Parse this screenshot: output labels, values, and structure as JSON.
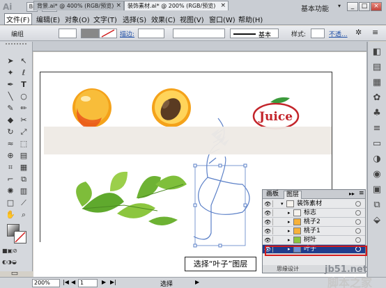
{
  "app": {
    "logo": "Ai",
    "workspace": "基本功能",
    "menus": [
      "文件(F)",
      "编辑(E)",
      "对象(O)",
      "文字(T)",
      "选择(S)",
      "效果(C)",
      "视图(V)",
      "窗口(W)",
      "帮助(H)"
    ]
  },
  "controlbar": {
    "mode_label": "编组",
    "stroke_label": "描边:",
    "style_name": "基本",
    "style_label": "样式:",
    "opacity_label": "不透..."
  },
  "tabs": [
    {
      "label": "背景.ai* @ 400% (RGB/预览)",
      "close": "×"
    },
    {
      "label": "装饰素材.ai* @ 200% (RGB/预览)",
      "close": "×"
    }
  ],
  "canvas": {
    "logo_text": "Juice"
  },
  "layers_panel": {
    "tabs": [
      "画板",
      "图层"
    ],
    "rows": [
      {
        "name": "装饰素材",
        "indent": 0,
        "selected": false
      },
      {
        "name": "标志",
        "indent": 1,
        "selected": false
      },
      {
        "name": "桃子2",
        "indent": 1,
        "selected": false
      },
      {
        "name": "桃子1",
        "indent": 1,
        "selected": false
      },
      {
        "name": "树叶",
        "indent": 1,
        "selected": false
      },
      {
        "name": "叶子",
        "indent": 1,
        "selected": true
      }
    ],
    "footer": "思缘设计"
  },
  "callout": "选择“叶子”图层",
  "statusbar": {
    "zoom": "200%",
    "page": "1",
    "tool": "选择"
  },
  "watermark": {
    "line1": "jb51.net",
    "line2": "脚本之家"
  },
  "colors": {
    "selection": "#1f3c8c",
    "highlight_box": "#d41b1b",
    "path_blue": "#5a7fc7"
  }
}
